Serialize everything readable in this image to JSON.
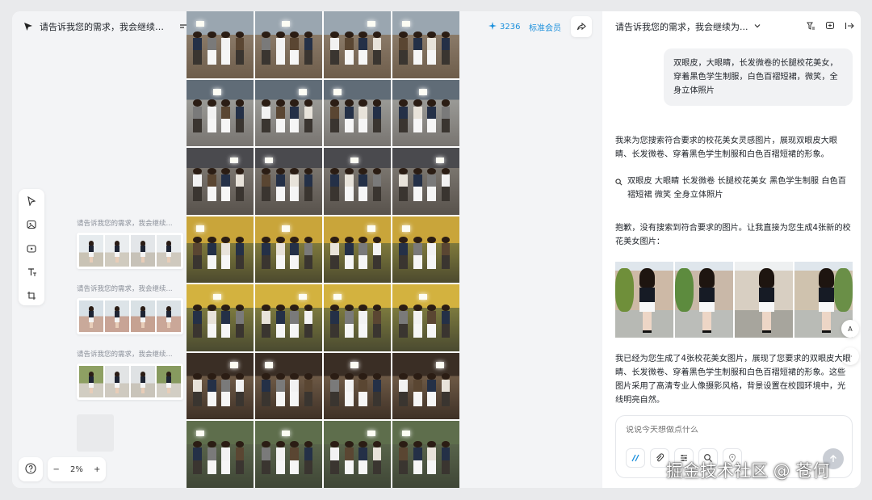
{
  "canvas": {
    "title": "请告诉我您的需求，我会继续为...",
    "credits": "3236",
    "membership": "标准会员",
    "zoom": "2%",
    "history": [
      {
        "label": "请告诉我您的需求，我会继续..."
      },
      {
        "label": "请告诉我您的需求，我会继续..."
      },
      {
        "label": "请告诉我您的需求，我会继续..."
      }
    ]
  },
  "chat": {
    "title": "请告诉我您的需求，我会继续为...",
    "user_message": "双眼皮，大眼睛，长发微卷的长腿校花美女，穿着黑色学生制服，白色百褶短裙，微笑，全身立体照片",
    "assistant_intro": "我来为您搜索符合要求的校花美女灵感图片，展现双眼皮大眼睛、长发微卷、穿着黑色学生制服和白色百褶短裙的形象。",
    "search_query": "双眼皮 大眼睛 长发微卷 长腿校花美女 黑色学生制服 白色百褶短裙 微笑 全身立体照片",
    "no_result": "抱歉，没有搜索到符合要求的图片。让我直接为您生成4张新的校花美女图片：",
    "summary": "我已经为您生成了4张校花美女图片，展现了您要求的双眼皮大眼睛、长发微卷、穿着黑色学生制服和白色百褶短裙的形象。这些图片采用了高清专业人像摄影风格，背景设置在校园环境中，光线明亮自然。",
    "input_placeholder": "说说今天想做点什么",
    "float_translate": "A",
    "float_bot": "··"
  },
  "watermark": "掘金技术社区 @ 苍何",
  "colors": {
    "accent": "#1a8fdc",
    "panel": "#ffffff",
    "canvas": "#f3f4f6"
  },
  "icons": {
    "logo": "pointer-logo-icon",
    "menu": "menu-icon",
    "select": "select-arrow-icon",
    "image": "image-icon",
    "video": "video-icon",
    "text": "text-icon",
    "crop": "crop-icon",
    "help": "help-icon",
    "share": "share-icon",
    "chevron": "chevron-down-icon"
  }
}
